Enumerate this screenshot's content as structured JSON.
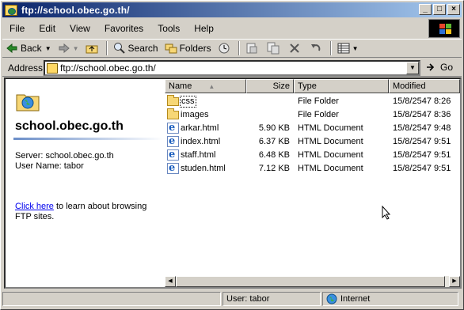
{
  "window": {
    "title": "ftp://school.obec.go.th/"
  },
  "title_buttons": {
    "minimize": "_",
    "maximize": "□",
    "close": "×"
  },
  "menu": [
    "File",
    "Edit",
    "View",
    "Favorites",
    "Tools",
    "Help"
  ],
  "toolbar": {
    "back": "Back",
    "search": "Search",
    "folders": "Folders"
  },
  "address": {
    "label": "Address",
    "value": "ftp://school.obec.go.th/",
    "go": "Go"
  },
  "left_pane": {
    "site": "school.obec.go.th",
    "server": "Server: school.obec.go.th",
    "user": "User Name: tabor",
    "link": "Click here",
    "help_text": " to learn about browsing FTP sites."
  },
  "columns": {
    "name": "Name",
    "size": "Size",
    "type": "Type",
    "modified": "Modified"
  },
  "files": [
    {
      "name": "css",
      "size": "",
      "type": "File Folder",
      "modified": "15/8/2547 8:26",
      "icon": "folder-icon"
    },
    {
      "name": "images",
      "size": "",
      "type": "File Folder",
      "modified": "15/8/2547 8:36",
      "icon": "folder-icon"
    },
    {
      "name": "arkar.html",
      "size": "5.90 KB",
      "type": "HTML Document",
      "modified": "15/8/2547 9:48",
      "icon": "html-file-icon"
    },
    {
      "name": "index.html",
      "size": "6.37 KB",
      "type": "HTML Document",
      "modified": "15/8/2547 9:51",
      "icon": "html-file-icon"
    },
    {
      "name": "staff.html",
      "size": "6.48 KB",
      "type": "HTML Document",
      "modified": "15/8/2547 9:51",
      "icon": "html-file-icon"
    },
    {
      "name": "studen.html",
      "size": "7.12 KB",
      "type": "HTML Document",
      "modified": "15/8/2547 9:51",
      "icon": "html-file-icon"
    }
  ],
  "status": {
    "user": "User: tabor",
    "zone": "Internet"
  }
}
